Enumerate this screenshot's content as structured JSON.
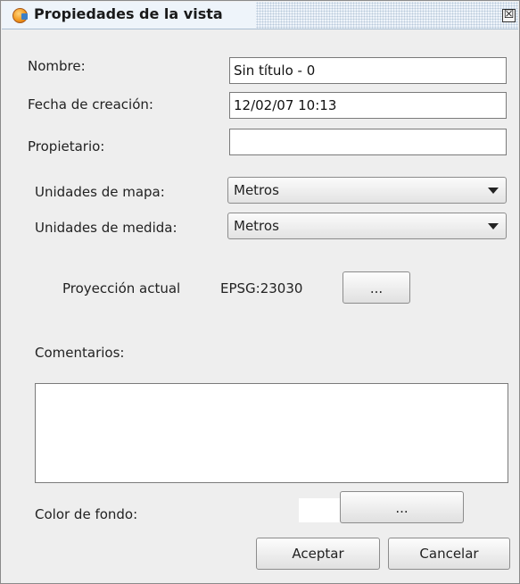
{
  "window": {
    "title": "Propiedades de la vista",
    "close_glyph": "☒",
    "icon": "gvsig-app-icon"
  },
  "fields": {
    "nombre_label": "Nombre:",
    "nombre_value": "Sin título - 0",
    "fecha_label": "Fecha de creación:",
    "fecha_value": "12/02/07 10:13",
    "propietario_label": "Propietario:",
    "propietario_value": ""
  },
  "units": {
    "mapa_label": "Unidades de mapa:",
    "mapa_value": "Metros",
    "medida_label": "Unidades de medida:",
    "medida_value": "Metros"
  },
  "projection": {
    "label": "Proyección actual",
    "value": "EPSG:23030",
    "button_label": "..."
  },
  "comments": {
    "label": "Comentarios:",
    "value": ""
  },
  "background": {
    "label": "Color de fondo:",
    "color": "#ffffff",
    "button_label": "..."
  },
  "actions": {
    "accept_label": "Aceptar",
    "cancel_label": "Cancelar"
  }
}
